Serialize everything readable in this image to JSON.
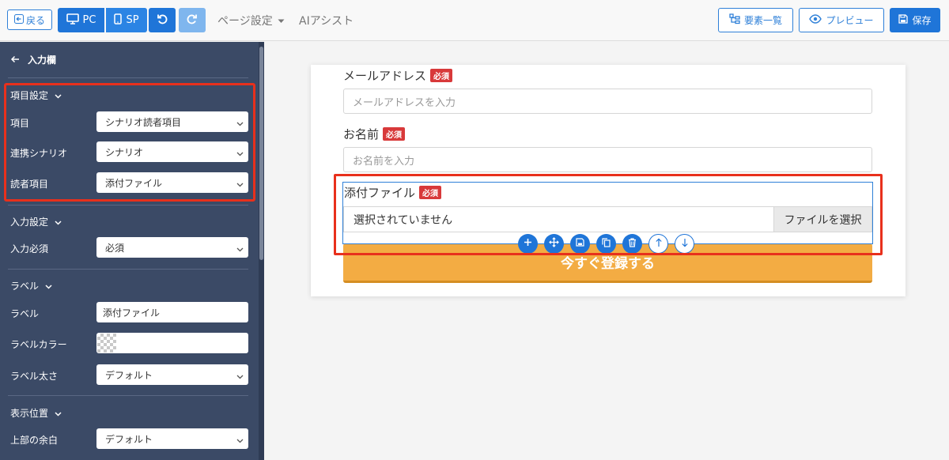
{
  "topbar": {
    "back_label": "戻る",
    "pc_label": "PC",
    "sp_label": "SP",
    "page_settings_label": "ページ設定",
    "ai_assist_label": "AIアシスト",
    "elements_label": "要素一覧",
    "preview_label": "プレビュー",
    "save_label": "保存"
  },
  "sidebar": {
    "title": "入力欄",
    "item_settings": {
      "heading": "項目設定",
      "item_label": "項目",
      "item_value": "シナリオ読者項目",
      "scenario_label": "連携シナリオ",
      "scenario_value": "シナリオ",
      "reader_label": "読者項目",
      "reader_value": "添付ファイル"
    },
    "input_settings": {
      "heading": "入力設定",
      "required_label": "入力必須",
      "required_value": "必須"
    },
    "label_section": {
      "heading": "ラベル",
      "label_label": "ラベル",
      "label_value": "添付ファイル",
      "color_label": "ラベルカラー",
      "weight_label": "ラベル太さ",
      "weight_value": "デフォルト"
    },
    "position_section": {
      "heading": "表示位置",
      "top_margin_label": "上部の余白",
      "top_margin_value": "デフォルト"
    }
  },
  "form": {
    "email_label": "メールアドレス",
    "email_placeholder": "メールアドレスを入力",
    "name_label": "お名前",
    "name_placeholder": "お名前を入力",
    "file_label": "添付ファイル",
    "file_status": "選択されていません",
    "file_button": "ファイルを選択",
    "required_badge": "必須",
    "submit_label": "今すぐ登録する"
  },
  "colors": {
    "accent": "#1f75d8",
    "sidebar_bg": "#3b4a66",
    "highlight": "#e8301c",
    "required": "#d8393a",
    "cta": "#f3ac43"
  }
}
